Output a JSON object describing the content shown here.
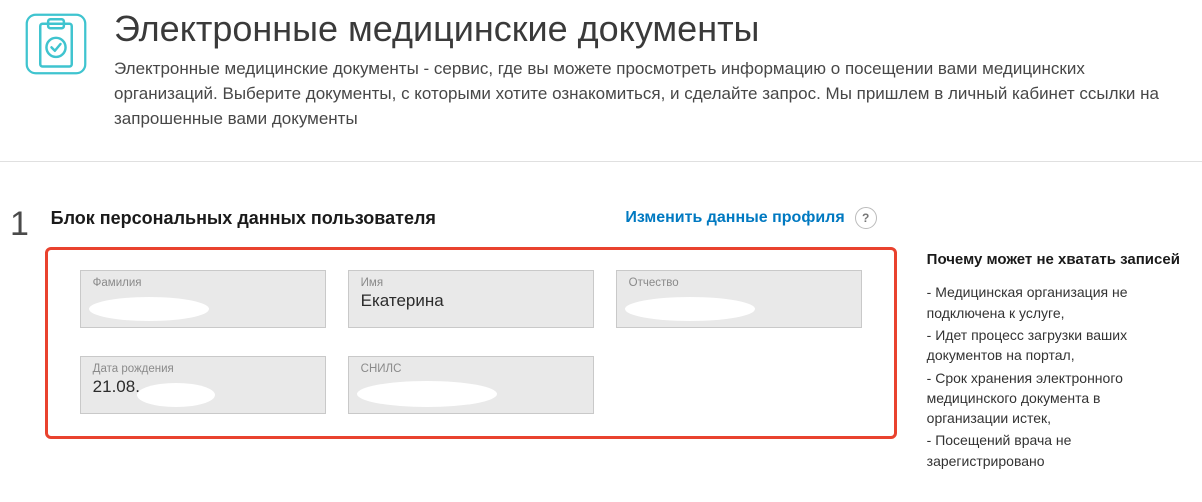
{
  "header": {
    "title": "Электронные медицинские документы",
    "description": "Электронные медицинские документы - сервис, где вы можете просмотреть информацию о посещении вами медицинских организаций. Выберите документы, с которыми хотите ознакомиться, и сделайте запрос. Мы пришлем в личный кабинет ссылки на запрошенные вами документы",
    "icon_color": "#3fc4cf"
  },
  "step": {
    "number": "1",
    "title": "Блок персональных данных пользователя",
    "edit_label": "Изменить данные профиля",
    "help": "?"
  },
  "fields": {
    "surname": {
      "label": "Фамилия",
      "value": ""
    },
    "name": {
      "label": "Имя",
      "value": "Екатерина"
    },
    "patronymic": {
      "label": "Отчество",
      "value": ""
    },
    "dob": {
      "label": "Дата рождения",
      "value": "21.08."
    },
    "snils": {
      "label": "СНИЛС",
      "value": ""
    }
  },
  "sidebar": {
    "heading": "Почему может не хватать записей",
    "items": [
      "- Медицинская организация не подключена к услуге,",
      "- Идет процесс загрузки ваших документов на портал,",
      "- Срок хранения электронного медицинского документа в организации истек,",
      "- Посещений врача не зарегистрировано"
    ]
  }
}
